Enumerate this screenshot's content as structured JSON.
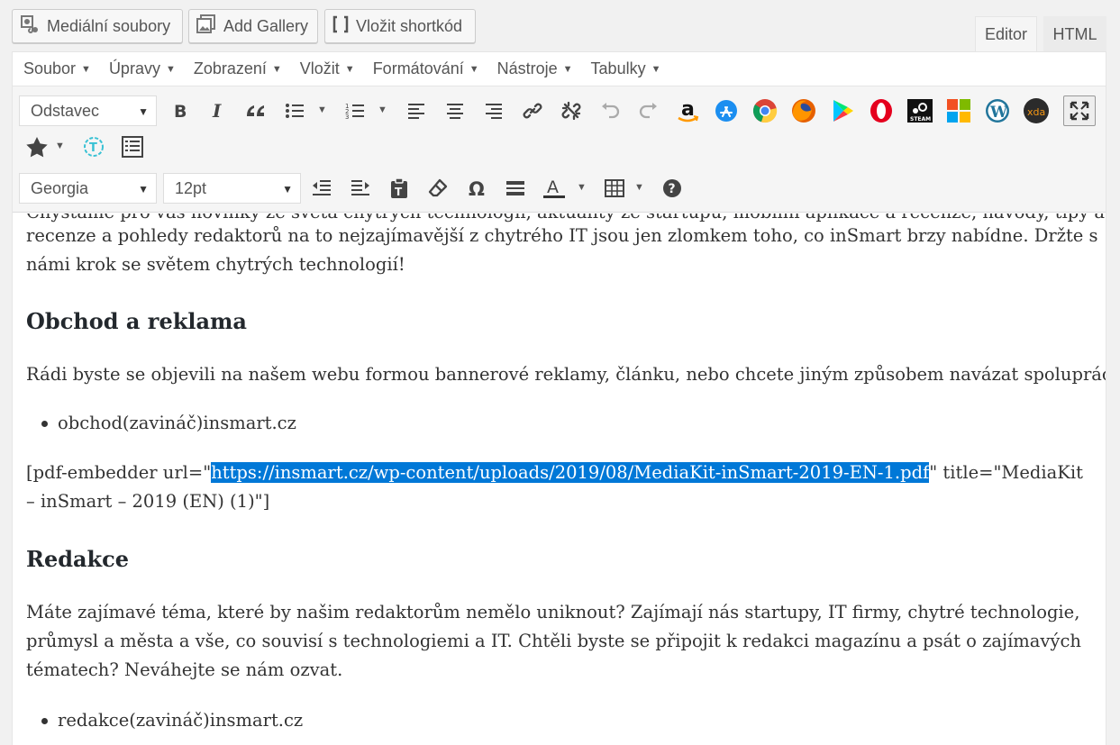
{
  "media_buttons": {
    "media": "Mediální soubory",
    "gallery": "Add Gallery",
    "shortcode": "Vložit shortkód"
  },
  "tabs": {
    "editor": "Editor",
    "html": "HTML"
  },
  "menubar": [
    "Soubor",
    "Úpravy",
    "Zobrazení",
    "Vložit",
    "Formátování",
    "Nástroje",
    "Tabulky"
  ],
  "toolbar": {
    "format_select": "Odstavec",
    "font_select": "Georgia",
    "size_select": "12pt"
  },
  "content": {
    "line_cut": "Chystáme pro vás novinky ze světa chytrých technologií, aktuality ze startupů, mobilní aplikace a recenze, návody, tipy a triky,",
    "line1": "recenze a pohledy redaktorů na to nejzajímavější z chytrého IT jsou jen zlomkem toho, co inSmart brzy nabídne. Držte s",
    "line2": "námi krok se světem chytrých technologií!",
    "heading1": "Obchod a reklama",
    "para2": "Rádi byste se objevili na našem webu formou bannerové reklamy, článku, nebo chcete jiným způsobem navázat spolupráci?",
    "bullet1": "obchod(zavináč)insmart.cz",
    "pdf_prefix": "[pdf-embedder url=\"",
    "pdf_url": "https://insmart.cz/wp-content/uploads/2019/08/MediaKit-inSmart-2019-EN-1.pdf",
    "pdf_suffix": "\" title=\"MediaKit",
    "pdf_line2": "– inSmart – 2019 (EN) (1)\"]",
    "heading2": "Redakce",
    "para3_l1": "Máte zajímavé téma, které by našim redaktorům nemělo uniknout? Zajímají nás startupy, IT firmy, chytré technologie,",
    "para3_l2": "průmysl a města a vše, co souvisí s technologiemi a IT. Chtěli byste se připojit k redakci magazínu a psát o zajímavých",
    "para3_l3": "tématech? Neváhejte se nám ozvat.",
    "bullet2": "redakce(zavináč)insmart.cz"
  }
}
